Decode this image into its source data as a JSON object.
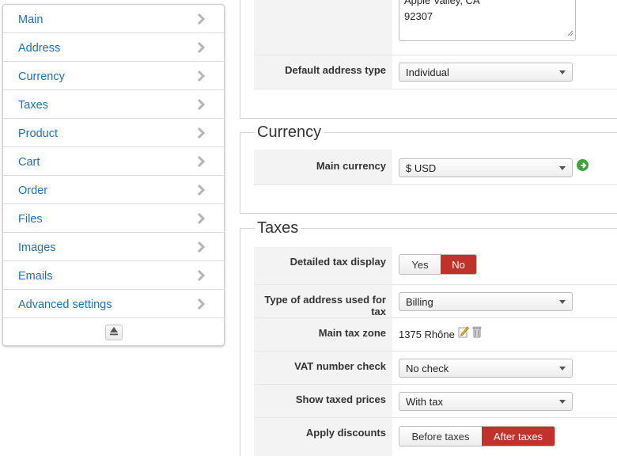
{
  "sidebar": {
    "items": [
      {
        "label": "Main"
      },
      {
        "label": "Address"
      },
      {
        "label": "Currency"
      },
      {
        "label": "Taxes"
      },
      {
        "label": "Product"
      },
      {
        "label": "Cart"
      },
      {
        "label": "Order"
      },
      {
        "label": "Files"
      },
      {
        "label": "Images"
      },
      {
        "label": "Emails"
      },
      {
        "label": "Advanced settings"
      }
    ]
  },
  "address": {
    "text_line_1": "Apple Valley, CA",
    "text_line_2": "92307",
    "default_type_label": "Default address type",
    "default_type_value": "Individual"
  },
  "currency": {
    "legend": "Currency",
    "main_label": "Main currency",
    "main_value": "$ USD"
  },
  "taxes": {
    "legend": "Taxes",
    "detailed_label": "Detailed tax display",
    "detailed_yes": "Yes",
    "detailed_no": "No",
    "address_type_label": "Type of address used for tax",
    "address_type_value": "Billing",
    "zone_label": "Main tax zone",
    "zone_value": "1375 Rhône",
    "vat_label": "VAT number check",
    "vat_value": "No check",
    "show_prices_label": "Show taxed prices",
    "show_prices_value": "With tax",
    "discounts_label": "Apply discounts",
    "discounts_before": "Before taxes",
    "discounts_after": "After taxes"
  },
  "colors": {
    "link": "#1f6fb2",
    "active": "#c0322b",
    "go": "#3ea43a"
  }
}
